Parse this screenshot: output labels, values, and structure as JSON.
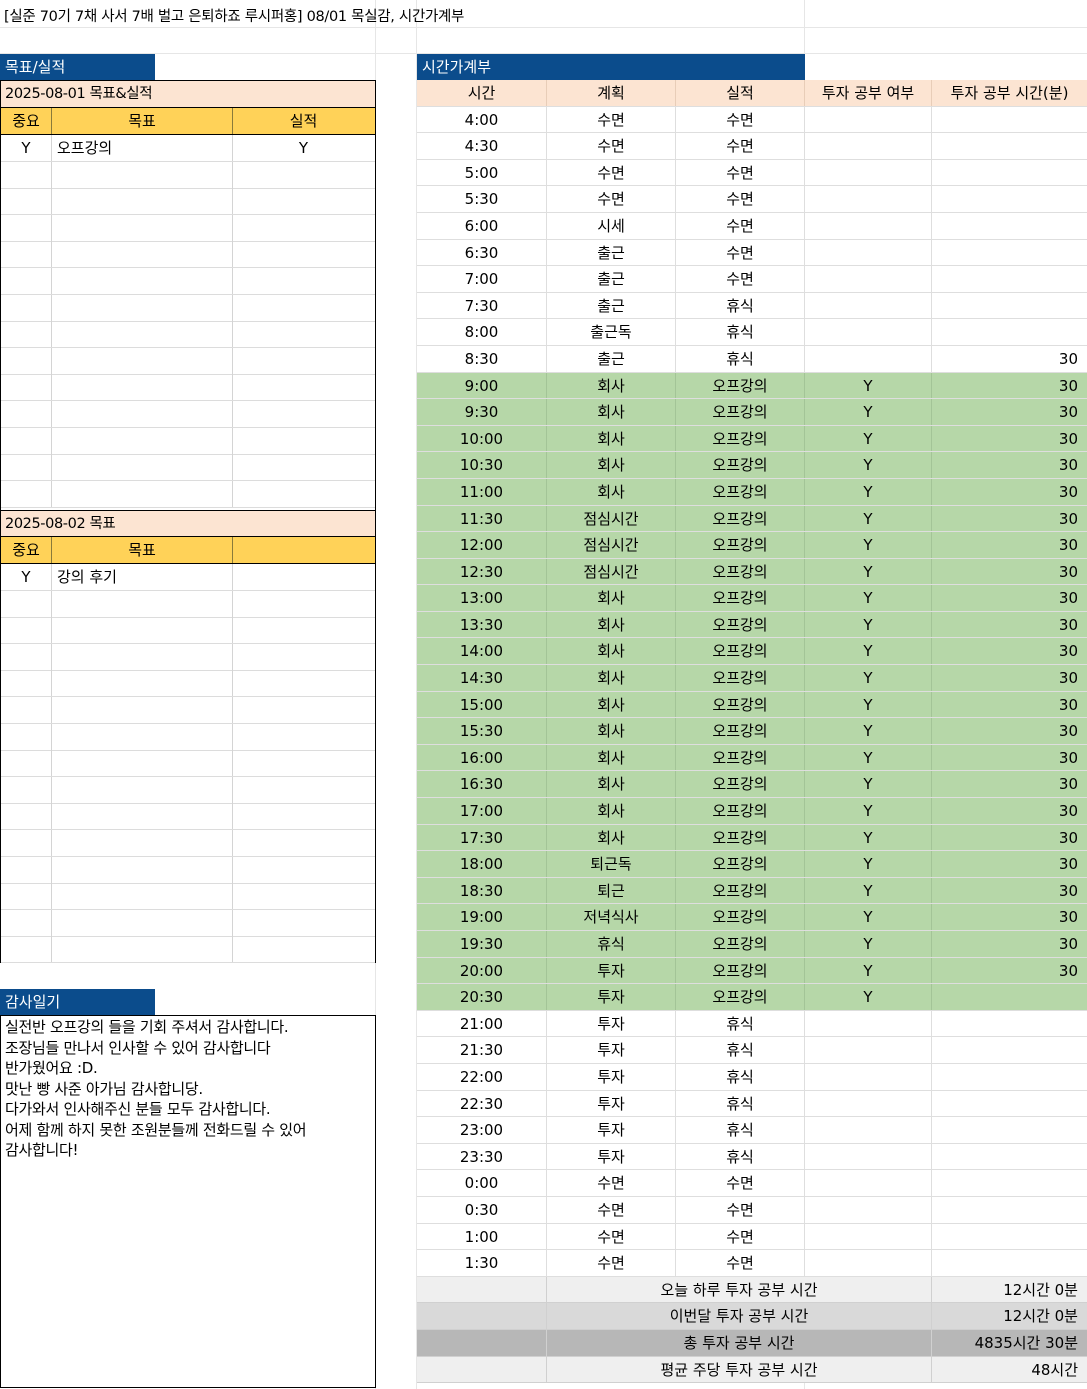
{
  "title": "[실준 70기 7채 사서 7배 벌고 은퇴하죠 루시퍼홍] 08/01 목실감, 시간가계부",
  "goals_section": {
    "header": "목표/실적",
    "today": {
      "date_label": "2025-08-01 목표&실적",
      "columns": [
        "중요",
        "목표",
        "실적"
      ],
      "rows": [
        {
          "important": "Y",
          "goal": "오프강의",
          "result": "Y"
        }
      ]
    },
    "tomorrow": {
      "date_label": "2025-08-02 목표",
      "columns": [
        "중요",
        "목표",
        ""
      ],
      "rows": [
        {
          "important": "Y",
          "goal": "강의 후기",
          "result": ""
        }
      ]
    }
  },
  "diary": {
    "header": "감사일기",
    "text": "실전반 오프강의 들을 기회 주셔서 감사합니다.\n조장님들 만나서 인사할 수 있어 감사합니다\n반가웠어요 :D.\n맛난 빵 사준 아가님 감사합니당.\n다가와서 인사해주신 분들 모두 감사합니다.\n어제 함께 하지 못한 조원분들께 전화드릴 수 있어\n감사합니다!"
  },
  "ledger": {
    "header": "시간가계부",
    "columns": [
      "시간",
      "계획",
      "실적",
      "투자 공부 여부",
      "투자 공부 시간(분)"
    ],
    "rows": [
      {
        "time": "4:00",
        "plan": "수면",
        "actual": "수면",
        "study": "",
        "minutes": ""
      },
      {
        "time": "4:30",
        "plan": "수면",
        "actual": "수면",
        "study": "",
        "minutes": ""
      },
      {
        "time": "5:00",
        "plan": "수면",
        "actual": "수면",
        "study": "",
        "minutes": ""
      },
      {
        "time": "5:30",
        "plan": "수면",
        "actual": "수면",
        "study": "",
        "minutes": ""
      },
      {
        "time": "6:00",
        "plan": "시세",
        "actual": "수면",
        "study": "",
        "minutes": ""
      },
      {
        "time": "6:30",
        "plan": "출근",
        "actual": "수면",
        "study": "",
        "minutes": ""
      },
      {
        "time": "7:00",
        "plan": "출근",
        "actual": "수면",
        "study": "",
        "minutes": ""
      },
      {
        "time": "7:30",
        "plan": "출근",
        "actual": "휴식",
        "study": "",
        "minutes": ""
      },
      {
        "time": "8:00",
        "plan": "출근독",
        "actual": "휴식",
        "study": "",
        "minutes": ""
      },
      {
        "time": "8:30",
        "plan": "출근",
        "actual": "휴식",
        "study": "",
        "minutes": "30"
      },
      {
        "time": "9:00",
        "plan": "회사",
        "actual": "오프강의",
        "study": "Y",
        "minutes": "30",
        "hl": true
      },
      {
        "time": "9:30",
        "plan": "회사",
        "actual": "오프강의",
        "study": "Y",
        "minutes": "30",
        "hl": true
      },
      {
        "time": "10:00",
        "plan": "회사",
        "actual": "오프강의",
        "study": "Y",
        "minutes": "30",
        "hl": true
      },
      {
        "time": "10:30",
        "plan": "회사",
        "actual": "오프강의",
        "study": "Y",
        "minutes": "30",
        "hl": true
      },
      {
        "time": "11:00",
        "plan": "회사",
        "actual": "오프강의",
        "study": "Y",
        "minutes": "30",
        "hl": true
      },
      {
        "time": "11:30",
        "plan": "점심시간",
        "actual": "오프강의",
        "study": "Y",
        "minutes": "30",
        "hl": true
      },
      {
        "time": "12:00",
        "plan": "점심시간",
        "actual": "오프강의",
        "study": "Y",
        "minutes": "30",
        "hl": true
      },
      {
        "time": "12:30",
        "plan": "점심시간",
        "actual": "오프강의",
        "study": "Y",
        "minutes": "30",
        "hl": true
      },
      {
        "time": "13:00",
        "plan": "회사",
        "actual": "오프강의",
        "study": "Y",
        "minutes": "30",
        "hl": true
      },
      {
        "time": "13:30",
        "plan": "회사",
        "actual": "오프강의",
        "study": "Y",
        "minutes": "30",
        "hl": true
      },
      {
        "time": "14:00",
        "plan": "회사",
        "actual": "오프강의",
        "study": "Y",
        "minutes": "30",
        "hl": true
      },
      {
        "time": "14:30",
        "plan": "회사",
        "actual": "오프강의",
        "study": "Y",
        "minutes": "30",
        "hl": true
      },
      {
        "time": "15:00",
        "plan": "회사",
        "actual": "오프강의",
        "study": "Y",
        "minutes": "30",
        "hl": true
      },
      {
        "time": "15:30",
        "plan": "회사",
        "actual": "오프강의",
        "study": "Y",
        "minutes": "30",
        "hl": true
      },
      {
        "time": "16:00",
        "plan": "회사",
        "actual": "오프강의",
        "study": "Y",
        "minutes": "30",
        "hl": true
      },
      {
        "time": "16:30",
        "plan": "회사",
        "actual": "오프강의",
        "study": "Y",
        "minutes": "30",
        "hl": true
      },
      {
        "time": "17:00",
        "plan": "회사",
        "actual": "오프강의",
        "study": "Y",
        "minutes": "30",
        "hl": true
      },
      {
        "time": "17:30",
        "plan": "회사",
        "actual": "오프강의",
        "study": "Y",
        "minutes": "30",
        "hl": true
      },
      {
        "time": "18:00",
        "plan": "퇴근독",
        "actual": "오프강의",
        "study": "Y",
        "minutes": "30",
        "hl": true
      },
      {
        "time": "18:30",
        "plan": "퇴근",
        "actual": "오프강의",
        "study": "Y",
        "minutes": "30",
        "hl": true
      },
      {
        "time": "19:00",
        "plan": "저녁식사",
        "actual": "오프강의",
        "study": "Y",
        "minutes": "30",
        "hl": true
      },
      {
        "time": "19:30",
        "plan": "휴식",
        "actual": "오프강의",
        "study": "Y",
        "minutes": "30",
        "hl": true
      },
      {
        "time": "20:00",
        "plan": "투자",
        "actual": "오프강의",
        "study": "Y",
        "minutes": "30",
        "hl": true
      },
      {
        "time": "20:30",
        "plan": "투자",
        "actual": "오프강의",
        "study": "Y",
        "minutes": "",
        "hl": true
      },
      {
        "time": "21:00",
        "plan": "투자",
        "actual": "휴식",
        "study": "",
        "minutes": ""
      },
      {
        "time": "21:30",
        "plan": "투자",
        "actual": "휴식",
        "study": "",
        "minutes": ""
      },
      {
        "time": "22:00",
        "plan": "투자",
        "actual": "휴식",
        "study": "",
        "minutes": ""
      },
      {
        "time": "22:30",
        "plan": "투자",
        "actual": "휴식",
        "study": "",
        "minutes": ""
      },
      {
        "time": "23:00",
        "plan": "투자",
        "actual": "휴식",
        "study": "",
        "minutes": ""
      },
      {
        "time": "23:30",
        "plan": "투자",
        "actual": "휴식",
        "study": "",
        "minutes": ""
      },
      {
        "time": "0:00",
        "plan": "수면",
        "actual": "수면",
        "study": "",
        "minutes": ""
      },
      {
        "time": "0:30",
        "plan": "수면",
        "actual": "수면",
        "study": "",
        "minutes": ""
      },
      {
        "time": "1:00",
        "plan": "수면",
        "actual": "수면",
        "study": "",
        "minutes": ""
      },
      {
        "time": "1:30",
        "plan": "수면",
        "actual": "수면",
        "study": "",
        "minutes": ""
      }
    ],
    "summary": [
      {
        "label": "오늘 하루 투자 공부 시간",
        "value": "12시간 0분"
      },
      {
        "label": "이번달 투자 공부 시간",
        "value": "12시간 0분"
      },
      {
        "label": "총 투자 공부 시간",
        "value": "4835시간 30분"
      },
      {
        "label": "평균 주당 투자 공부 시간",
        "value": "48시간"
      }
    ]
  },
  "colors": {
    "header_blue": "#0b4c8c",
    "peach": "#fce4d2",
    "gold": "#ffd258",
    "green_highlight": "#b6d7a8"
  }
}
